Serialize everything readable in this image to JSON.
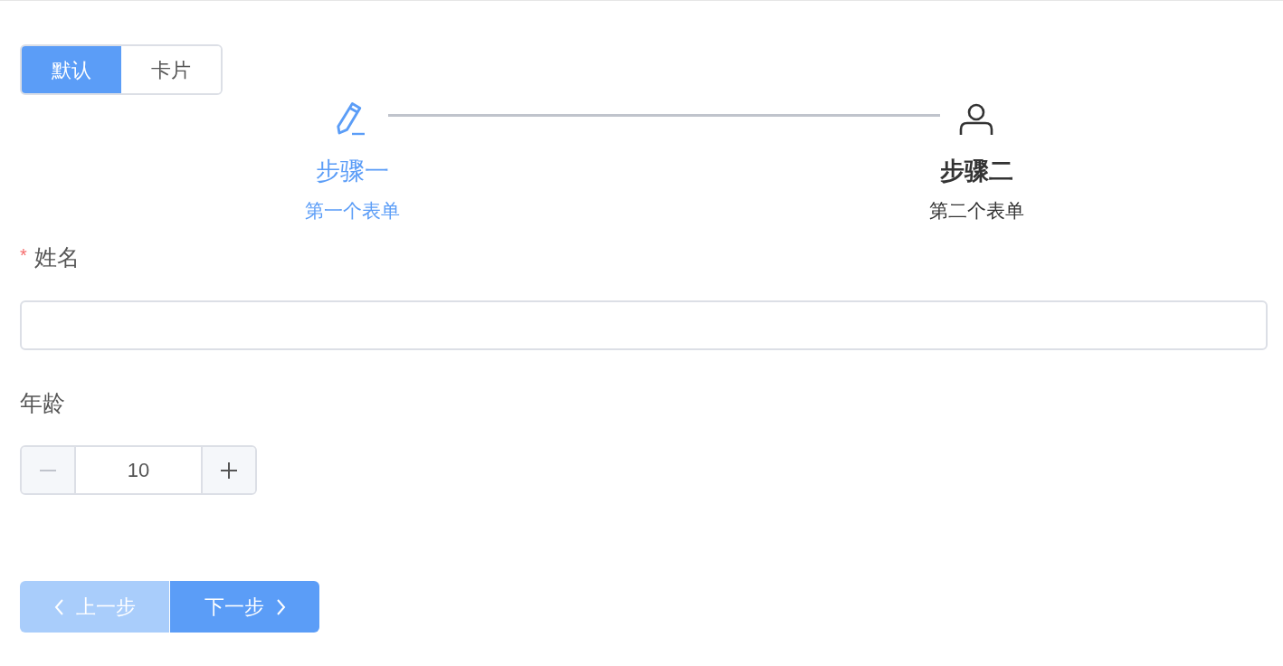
{
  "segmented": [
    {
      "label": "默认",
      "selected": true
    },
    {
      "label": "卡片",
      "selected": false
    }
  ],
  "steps": [
    {
      "title": "步骤一",
      "description": "第一个表单",
      "kind": "edit",
      "current": false
    },
    {
      "title": "步骤二",
      "description": "第二个表单",
      "kind": "user",
      "current": true
    }
  ],
  "fields": [
    {
      "kind": "text",
      "label": "姓名",
      "required_mark": "*"
    },
    {
      "kind": "number",
      "label": "年龄",
      "value": "10",
      "minus_disabled": true
    }
  ],
  "buttons": [
    {
      "label": "上一步",
      "kind": "prev",
      "disabled": true
    },
    {
      "label": "下一步",
      "kind": "next",
      "disabled": false
    }
  ]
}
